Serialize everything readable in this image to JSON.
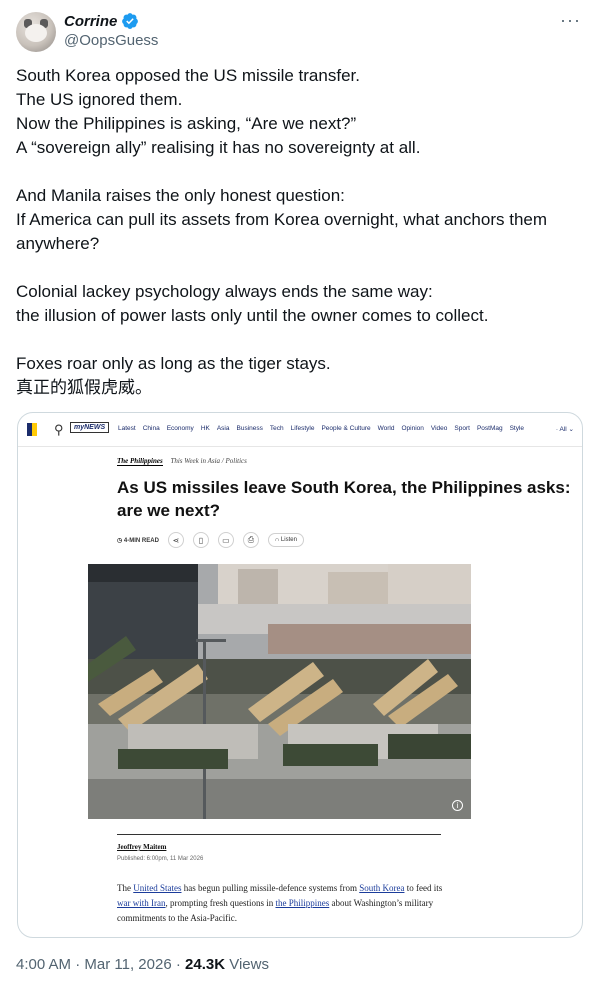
{
  "author": {
    "display_name": "Corrine",
    "handle": "@OopsGuess",
    "verified_color": "#1d9bf0",
    "more_icon": "more-horizontal-icon"
  },
  "tweet": {
    "paragraphs": [
      [
        "South Korea opposed the US missile transfer.",
        "The US ignored them.",
        "Now the Philippines is asking, “Are we next?”",
        "A “sovereign ally” realising it has no sovereignty at all."
      ],
      [
        "And Manila raises the only honest question:",
        "If America can pull its assets from Korea overnight, what anchors them anywhere?"
      ],
      [
        "Colonial lackey psychology always ends the same way:",
        "the illusion of power lasts only until the owner comes to collect."
      ],
      [
        "Foxes roar only as long as the tiger stays.",
        "真正的狐假虎威。"
      ]
    ]
  },
  "card": {
    "nav": {
      "mynews": "myNEWS",
      "items": [
        "Latest",
        "China",
        "Economy",
        "HK",
        "Asia",
        "Business",
        "Tech",
        "Lifestyle",
        "People & Culture",
        "World",
        "Opinion",
        "Video",
        "Sport",
        "PostMag",
        "Style"
      ],
      "all": "All"
    },
    "section": "The Philippines",
    "section_sub": "This Week in Asia / Politics",
    "headline": "As US missiles leave South Korea, the Philippines asks: are we next?",
    "read_time": "4-MIN READ",
    "listen": "Listen",
    "author": "Jeoffrey Maitem",
    "published": "Published: 6:00pm, 11 Mar 2026",
    "body": {
      "t1": "The ",
      "l1": "United States",
      "t2": " has begun pulling missile-defence systems from ",
      "l2": "South Korea",
      "t3": " to feed its ",
      "l3": "war with Iran",
      "t4": ", prompting fresh questions in ",
      "l4": "the Philippines",
      "t5": " about Washington’s military commitments to the Asia-Pacific."
    }
  },
  "meta": {
    "time": "4:00 AM",
    "date": "Mar 11, 2026",
    "views_count": "24.3K",
    "views_label": "Views"
  }
}
